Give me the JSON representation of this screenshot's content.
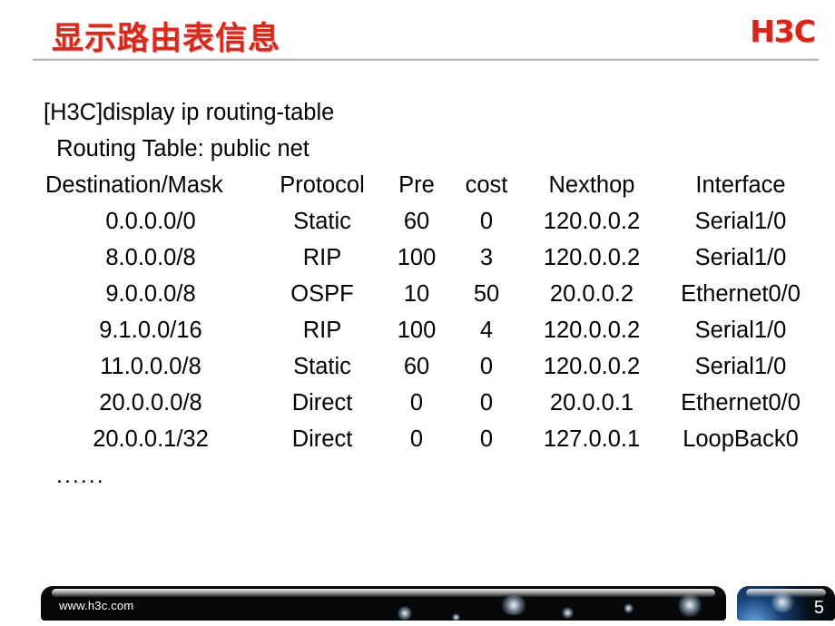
{
  "header": {
    "title": "显示路由表信息",
    "logo": "H3C"
  },
  "console": {
    "command_line": "[H3C]display ip routing-table",
    "table_caption": " Routing Table: public net",
    "ellipsis": "......"
  },
  "chart_data": {
    "type": "table",
    "title": "Routing Table: public net",
    "columns": [
      "Destination/Mask",
      "Protocol",
      "Pre",
      "cost",
      "Nexthop",
      "Interface"
    ],
    "rows": [
      [
        "0.0.0.0/0",
        "Static",
        "60",
        "0",
        "120.0.0.2",
        "Serial1/0"
      ],
      [
        "8.0.0.0/8",
        "RIP",
        "100",
        "3",
        "120.0.0.2",
        "Serial1/0"
      ],
      [
        "9.0.0.0/8",
        "OSPF",
        "10",
        "50",
        "20.0.0.2",
        "Ethernet0/0"
      ],
      [
        "9.1.0.0/16",
        "RIP",
        "100",
        "4",
        "120.0.0.2",
        "Serial1/0"
      ],
      [
        "11.0.0.0/8",
        "Static",
        "60",
        "0",
        "120.0.0.2",
        "Serial1/0"
      ],
      [
        "20.0.0.0/8",
        "Direct",
        "0",
        "0",
        "20.0.0.1",
        "Ethernet0/0"
      ],
      [
        "20.0.0.1/32",
        "Direct",
        "0",
        "0",
        "127.0.0.1",
        "LoopBack0"
      ]
    ]
  },
  "footer": {
    "url": "www.h3c.com",
    "page_number": "5"
  },
  "colors": {
    "title_red": "#d42b1e",
    "logo_red": "#d8251c",
    "text_black": "#000000",
    "footer_dark": "#07080a",
    "footer_blue": "#2b6ebd"
  }
}
